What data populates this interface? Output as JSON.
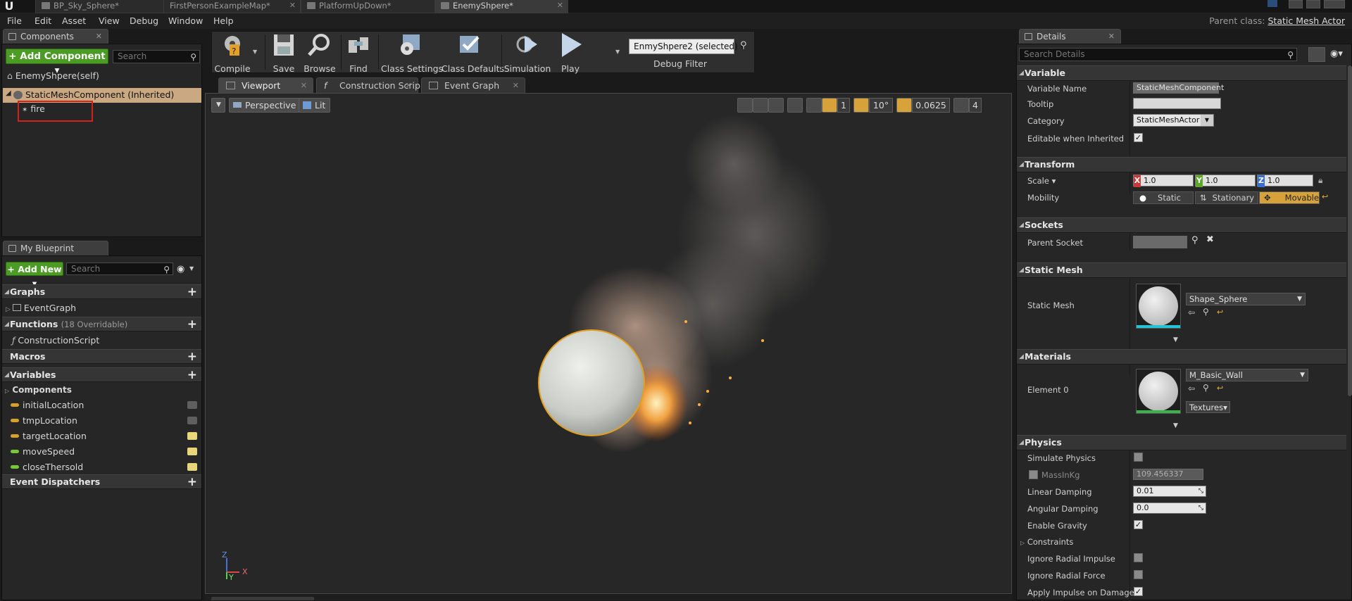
{
  "title_tabs": [
    {
      "label": "BP_Sky_Sphere*"
    },
    {
      "label": "FirstPersonExampleMap*"
    },
    {
      "label": "PlatformUpDown*"
    },
    {
      "label": "EnemyShpere*"
    }
  ],
  "menu": [
    "File",
    "Edit",
    "Asset",
    "View",
    "Debug",
    "Window",
    "Help"
  ],
  "parent_class": {
    "label": "Parent class:",
    "value": "Static Mesh Actor"
  },
  "components": {
    "tab": "Components",
    "add_button": "+ Add Component ▾",
    "search_placeholder": "Search",
    "self_label": "EnemyShpere(self)",
    "root_component": "StaticMeshComponent (Inherited)",
    "child_component": "fire"
  },
  "my_blueprint": {
    "tab": "My Blueprint",
    "add_button": "+ Add New ▾",
    "search_placeholder": "Search",
    "graphs": "Graphs",
    "event_graph": "EventGraph",
    "functions": "Functions",
    "functions_note": "(18 Overridable)",
    "construction_script": "ConstructionScript",
    "macros": "Macros",
    "variables": "Variables",
    "components_cat": "Components",
    "vars": [
      {
        "name": "initialLocation",
        "color": "#d6a02c",
        "visible": false
      },
      {
        "name": "tmpLocation",
        "color": "#d6a02c",
        "visible": false
      },
      {
        "name": "targetLocation",
        "color": "#d6a02c",
        "visible": true
      },
      {
        "name": "moveSpeed",
        "color": "#76c83a",
        "visible": true
      },
      {
        "name": "closeThersold",
        "color": "#76c83a",
        "visible": true
      }
    ],
    "event_dispatchers": "Event Dispatchers"
  },
  "toolbar": {
    "compile": "Compile",
    "save": "Save",
    "browse": "Browse",
    "find": "Find",
    "class_settings": "Class Settings",
    "class_defaults": "Class Defaults",
    "simulation": "Simulation",
    "play": "Play",
    "debug_object": "EnmyShpere2 (selected) ▾",
    "debug_filter": "Debug Filter"
  },
  "editor_tabs": [
    {
      "label": "Viewport"
    },
    {
      "label": "Construction Scrip"
    },
    {
      "label": "Event Graph"
    }
  ],
  "viewport": {
    "perspective": "Perspective",
    "lit": "Lit",
    "grid_snap": "1",
    "rotation_snap": "10°",
    "scale_snap": "0.0625",
    "camera_speed": "4",
    "axis_x": "X",
    "axis_y": "Y",
    "axis_z": "Z"
  },
  "details": {
    "tab": "Details",
    "search_placeholder": "Search Details",
    "variable": {
      "heading": "Variable",
      "name_label": "Variable Name",
      "name_value": "StaticMeshComponent",
      "tooltip_label": "Tooltip",
      "tooltip_value": "",
      "category_label": "Category",
      "category_value": "StaticMeshActor",
      "editable_label": "Editable when Inherited"
    },
    "transform": {
      "heading": "Transform",
      "scale_label": "Scale ▾",
      "x": "1.0",
      "y": "1.0",
      "z": "1.0",
      "mobility_label": "Mobility",
      "static": "Static",
      "stationary": "Stationary",
      "movable": "Movable"
    },
    "sockets": {
      "heading": "Sockets",
      "parent_socket": "Parent Socket"
    },
    "static_mesh": {
      "heading": "Static Mesh",
      "label": "Static Mesh",
      "value": "Shape_Sphere"
    },
    "materials": {
      "heading": "Materials",
      "label": "Element 0",
      "value": "M_Basic_Wall",
      "textures": "Textures▾"
    },
    "physics": {
      "heading": "Physics",
      "simulate": "Simulate Physics",
      "mass_label": "MassInKg",
      "mass_value": "109.456337",
      "linear_label": "Linear Damping",
      "linear_value": "0.01",
      "angular_label": "Angular Damping",
      "angular_value": "0.0",
      "gravity": "Enable Gravity",
      "constraints": "Constraints",
      "radial_impulse": "Ignore Radial Impulse",
      "radial_force": "Ignore Radial Force",
      "impulse_damage": "Apply Impulse on Damage"
    }
  },
  "colors": {
    "accent_green": "#4b9b25",
    "movable": "#d8a23a",
    "selection": "#c9a882"
  }
}
